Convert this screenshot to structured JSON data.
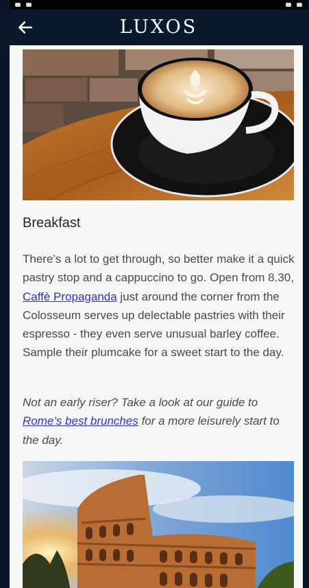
{
  "app": {
    "brand": "LUXOS"
  },
  "article": {
    "section_title": "Breakfast",
    "para1_before_link": "There’s a lot to get through, so better make it a quick pastry stop and a cappuccino to go. Open from 8.30, ",
    "para1_link": "Caffè Propaganda",
    "para1_after_link": " just around the corner from the Colosseum serves up delectable pastries with their espresso - they even serve unusual barley coffee. Sample their plumcake for a sweet start to the day.",
    "para2_before_link": "Not an early riser? Take a look at our guide to ",
    "para2_link": "Rome’s best brunches",
    "para2_after_link": " for a more leisurely start to the day."
  },
  "icons": {
    "back": "arrow-left-icon"
  },
  "colors": {
    "app_bar": "#0a1a2e",
    "content_bg": "#f6f6f4",
    "link": "#2a34c8",
    "body_text": "#4a4a4a"
  }
}
